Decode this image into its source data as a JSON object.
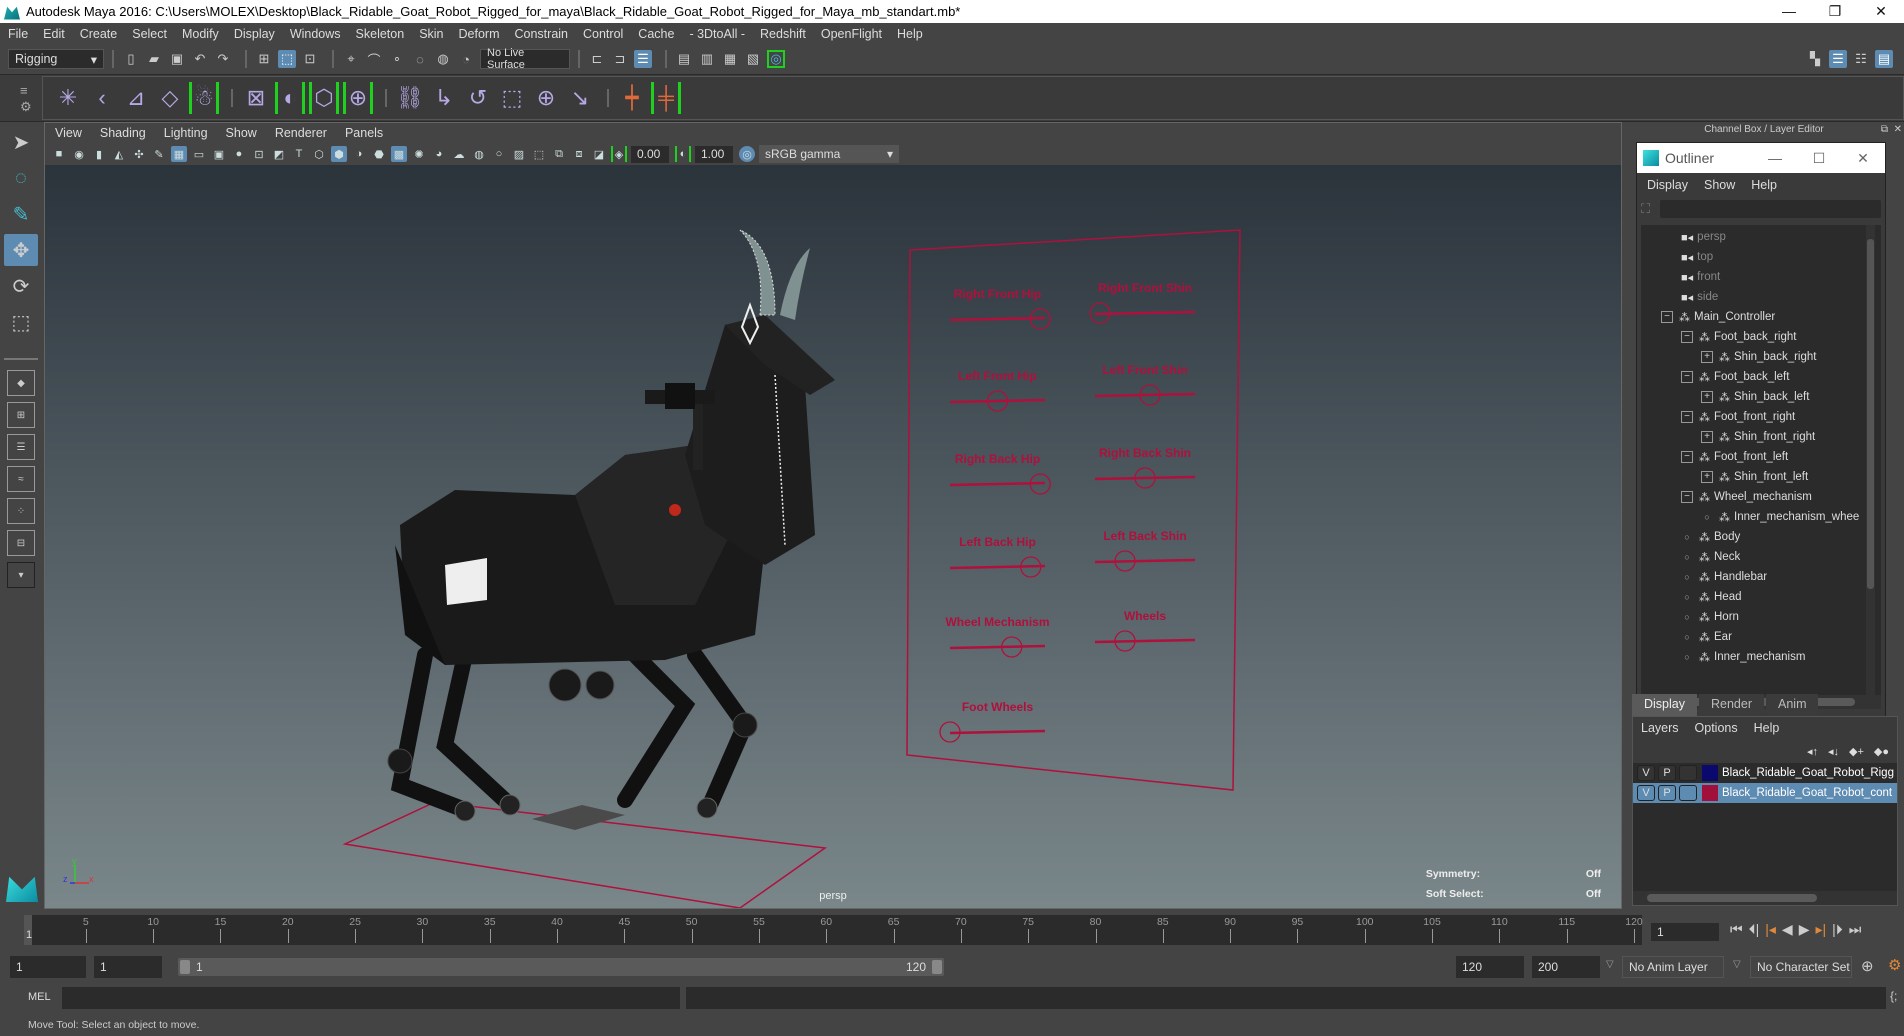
{
  "window": {
    "title": "Autodesk Maya 2016: C:\\Users\\MOLEX\\Desktop\\Black_Ridable_Goat_Robot_Rigged_for_maya\\Black_Ridable_Goat_Robot_Rigged_for_Maya_mb_standart.mb*",
    "minimize": "—",
    "restore": "❐",
    "close": "✕"
  },
  "menubar": [
    "File",
    "Edit",
    "Create",
    "Select",
    "Modify",
    "Display",
    "Windows",
    "Skeleton",
    "Skin",
    "Deform",
    "Constrain",
    "Control",
    "Cache",
    "- 3DtoAll -",
    "Redshift",
    "OpenFlight",
    "Help"
  ],
  "statusline": {
    "menuset": "Rigging",
    "live_surface": "No Live Surface"
  },
  "viewport": {
    "menu": [
      "View",
      "Shading",
      "Lighting",
      "Show",
      "Renderer",
      "Panels"
    ],
    "exposure": "0.00",
    "gamma": "1.00",
    "color_space": "sRGB gamma",
    "camera_label": "persp",
    "symmetry_label": "Symmetry:",
    "symmetry_value": "Off",
    "soft_select_label": "Soft Select:",
    "soft_select_value": "Off",
    "axis": {
      "x": "x",
      "y": "y",
      "z": "z"
    },
    "controls": [
      {
        "label": "Right Front Hip",
        "value": 0.95
      },
      {
        "label": "Right Front Shin",
        "value": 0.05
      },
      {
        "label": "Left Front Hip",
        "value": 0.5
      },
      {
        "label": "Left Front Shin",
        "value": 0.55
      },
      {
        "label": "Right Back Hip",
        "value": 0.95
      },
      {
        "label": "Right Back Shin",
        "value": 0.5
      },
      {
        "label": "Left Back Hip",
        "value": 0.85
      },
      {
        "label": "Left Back Shin",
        "value": 0.3
      },
      {
        "label": "Wheel Mechanism",
        "value": 0.65
      },
      {
        "label": "Wheels",
        "value": 0.3
      },
      {
        "label": "Foot Wheels",
        "value": 0.0
      }
    ]
  },
  "right_panel": {
    "title": "Channel Box / Layer Editor",
    "outliner": {
      "title": "Outliner",
      "menu": [
        "Display",
        "Show",
        "Help"
      ],
      "items": [
        {
          "label": "persp",
          "type": "camera",
          "depth": 0
        },
        {
          "label": "top",
          "type": "camera",
          "depth": 0
        },
        {
          "label": "front",
          "type": "camera",
          "depth": 0
        },
        {
          "label": "side",
          "type": "camera",
          "depth": 0
        },
        {
          "label": "Main_Controller",
          "type": "node",
          "depth": 0,
          "expander": "−"
        },
        {
          "label": "Foot_back_right",
          "type": "node",
          "depth": 1,
          "expander": "−"
        },
        {
          "label": "Shin_back_right",
          "type": "node",
          "depth": 2,
          "expander": "+"
        },
        {
          "label": "Foot_back_left",
          "type": "node",
          "depth": 1,
          "expander": "−"
        },
        {
          "label": "Shin_back_left",
          "type": "node",
          "depth": 2,
          "expander": "+"
        },
        {
          "label": "Foot_front_right",
          "type": "node",
          "depth": 1,
          "expander": "−"
        },
        {
          "label": "Shin_front_right",
          "type": "node",
          "depth": 2,
          "expander": "+"
        },
        {
          "label": "Foot_front_left",
          "type": "node",
          "depth": 1,
          "expander": "−"
        },
        {
          "label": "Shin_front_left",
          "type": "node",
          "depth": 2,
          "expander": "+"
        },
        {
          "label": "Wheel_mechanism",
          "type": "node",
          "depth": 1,
          "expander": "−"
        },
        {
          "label": "Inner_mechanism_whee",
          "type": "node",
          "depth": 2,
          "expander": "o"
        },
        {
          "label": "Body",
          "type": "node",
          "depth": 1,
          "expander": "o"
        },
        {
          "label": "Neck",
          "type": "node",
          "depth": 1,
          "expander": "o"
        },
        {
          "label": "Handlebar",
          "type": "node",
          "depth": 1,
          "expander": "o"
        },
        {
          "label": "Head",
          "type": "node",
          "depth": 1,
          "expander": "o"
        },
        {
          "label": "Horn",
          "type": "node",
          "depth": 1,
          "expander": "o"
        },
        {
          "label": "Ear",
          "type": "node",
          "depth": 1,
          "expander": "o"
        },
        {
          "label": "Inner_mechanism",
          "type": "node",
          "depth": 1,
          "expander": "o"
        }
      ]
    },
    "layer_editor": {
      "tabs": [
        "Display",
        "Render",
        "Anim"
      ],
      "active_tab": "Display",
      "menu": [
        "Layers",
        "Options",
        "Help"
      ],
      "layers": [
        {
          "v": "V",
          "p": "P",
          "color": "#0a0a6e",
          "name": "Black_Ridable_Goat_Robot_Rigg",
          "selected": false
        },
        {
          "v": "V",
          "p": "P",
          "color": "#a0103a",
          "name": "Black_Ridable_Goat_Robot_cont",
          "selected": true
        }
      ]
    }
  },
  "timeline": {
    "ticks": [
      5,
      10,
      15,
      20,
      25,
      30,
      35,
      40,
      45,
      50,
      55,
      60,
      65,
      70,
      75,
      80,
      85,
      90,
      95,
      100,
      105,
      110,
      115,
      120
    ],
    "min": 1,
    "max": 120,
    "current_frame": "1",
    "current_field": "1"
  },
  "range": {
    "start": "1",
    "playback_start": "1",
    "slider_start": "1",
    "slider_end": "120",
    "playback_end": "120",
    "end": "200",
    "anim_layer": "No Anim Layer",
    "character_set": "No Character Set"
  },
  "command": {
    "lang": "MEL"
  },
  "help_line": "Move Tool: Select an object to move."
}
